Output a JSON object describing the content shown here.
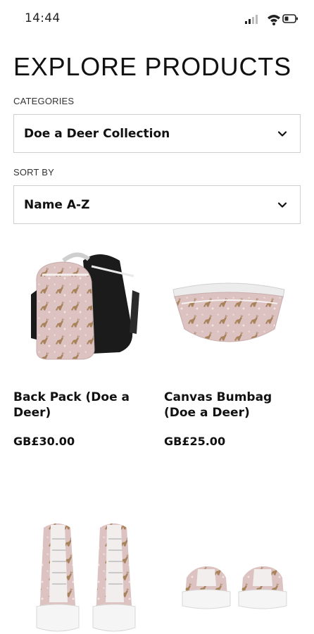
{
  "status_bar": {
    "time": "14:44"
  },
  "page": {
    "title": "EXPLORE PRODUCTS"
  },
  "filters": {
    "categories_label": "CATEGORIES",
    "categories_value": "Doe a Deer Collection",
    "sort_label": "SORT BY",
    "sort_value": "Name A-Z"
  },
  "products": [
    {
      "name": "Back Pack (Doe a Deer)",
      "price": "GB£30.00",
      "image": "backpack-image"
    },
    {
      "name": "Canvas Bumbag (Doe a Deer)",
      "price": "GB£25.00",
      "image": "bumbag-image"
    },
    {
      "name": "",
      "price": "",
      "image": "high-top-sneakers-image"
    },
    {
      "name": "",
      "price": "",
      "image": "low-top-sneakers-image"
    }
  ],
  "colors": {
    "print_pink": "#dcc3c1",
    "deer_brown": "#a8825a",
    "bag_black": "#1b1b1b",
    "border": "#cfcfcf"
  }
}
